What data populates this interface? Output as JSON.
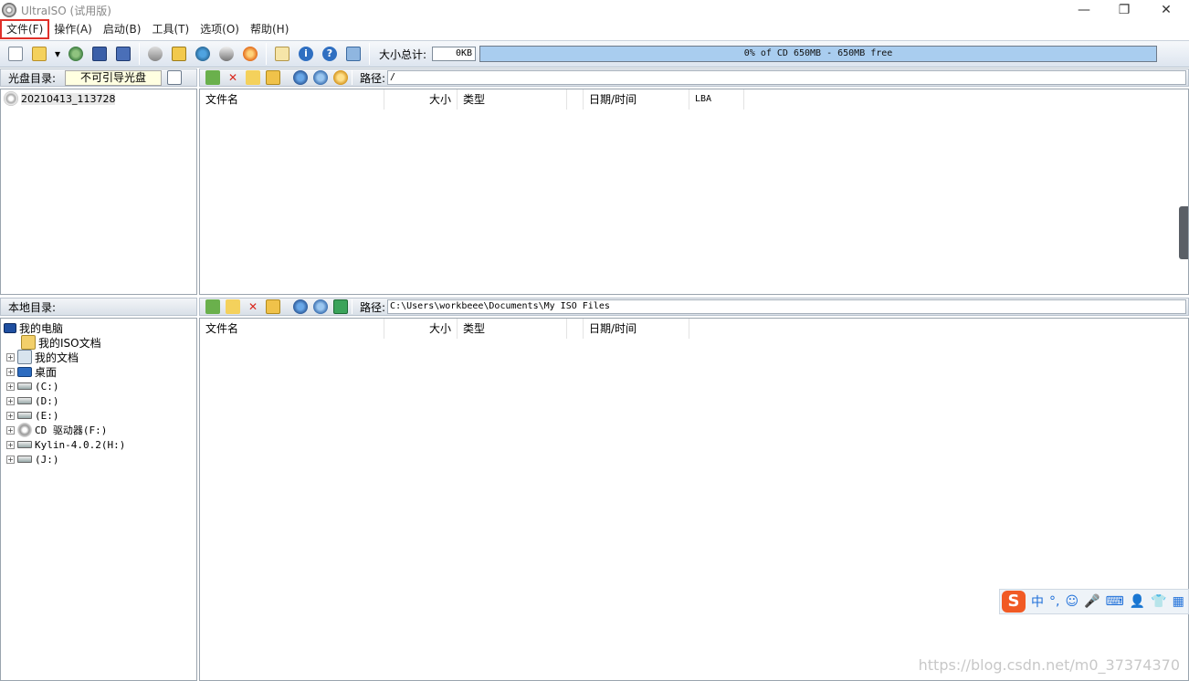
{
  "window": {
    "title": "UltraISO (试用版)",
    "controls": [
      "—",
      "❐",
      "✕"
    ]
  },
  "menu": [
    "文件(F)",
    "操作(A)",
    "启动(B)",
    "工具(T)",
    "选项(O)",
    "帮助(H)"
  ],
  "toolbar": {
    "size_label": "大小总计:",
    "size_value": "0KB",
    "capacity": "0% of CD 650MB - 650MB free"
  },
  "iso_panel": {
    "label": "光盘目录:",
    "boot": "不可引导光盘",
    "path_label": "路径:",
    "path": "/",
    "root": "20210413_113728",
    "columns": [
      "文件名",
      "大小",
      "类型",
      "日期/时间",
      "LBA"
    ]
  },
  "local_panel": {
    "label": "本地目录:",
    "path_label": "路径:",
    "path": "C:\\Users\\workbeee\\Documents\\My ISO Files",
    "columns": [
      "文件名",
      "大小",
      "类型",
      "日期/时间"
    ],
    "tree": [
      "我的电脑",
      "我的ISO文档",
      "我的文档",
      "桌面",
      "(C:)",
      "(D:)",
      "(E:)",
      "CD 驱动器(F:)",
      "Kylin-4.0.2(H:)",
      "(J:)"
    ]
  },
  "ime": {
    "logo": "S",
    "items": [
      "中",
      "°,",
      "☺",
      "🎤",
      "⌨",
      "👤",
      "👕",
      "▦"
    ]
  },
  "watermark": "https://blog.csdn.net/m0_37374370"
}
